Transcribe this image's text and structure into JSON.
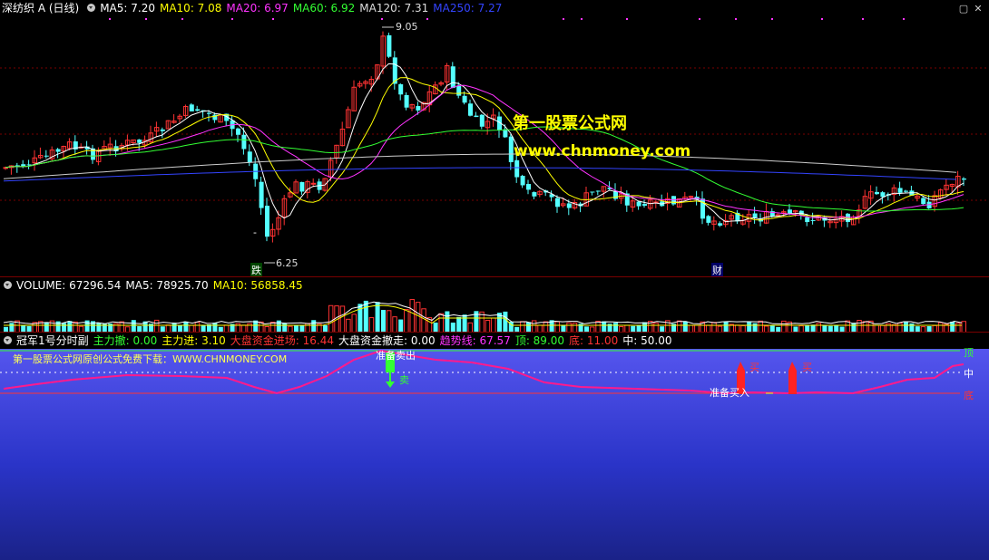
{
  "main": {
    "title": "深纺织 A (日线)",
    "ma_labels": [
      {
        "text": "MA5: 7.20",
        "color": "#ffffff"
      },
      {
        "text": "MA10: 7.08",
        "color": "#ffff00"
      },
      {
        "text": "MA20: 6.97",
        "color": "#ff33ff"
      },
      {
        "text": "MA60: 6.92",
        "color": "#33ff33"
      },
      {
        "text": "MA120: 7.31",
        "color": "#dddddd"
      },
      {
        "text": "MA250: 7.27",
        "color": "#3344ff"
      }
    ],
    "high_label": "9.05",
    "low_label": "6.25",
    "marker_die": "跌",
    "marker_cai": "财",
    "watermark_cn": "第一股票公式网",
    "watermark_url": "www.chnmoney.com",
    "ask_marker": "-"
  },
  "volume": {
    "labels": [
      {
        "text": "VOLUME: 67296.54",
        "color": "#ffffff"
      },
      {
        "text": "MA5: 78925.70",
        "color": "#ffffff"
      },
      {
        "text": "MA10: 56858.45",
        "color": "#ffff00"
      }
    ]
  },
  "indicator": {
    "title": "冠军1号分时副",
    "labels": [
      {
        "text": "主力撤: 0.00",
        "color": "#33ff33"
      },
      {
        "text": "主力进: 3.10",
        "color": "#ffff00"
      },
      {
        "text": "大盘资金进场: 16.44",
        "color": "#ff3333"
      },
      {
        "text": "大盘资金撤走: 0.00",
        "color": "#ffffff"
      },
      {
        "text": "趋势线: 67.57",
        "color": "#ff33ff"
      },
      {
        "text": "顶: 89.00",
        "color": "#33ff33"
      },
      {
        "text": "底: 11.00",
        "color": "#ff3333"
      },
      {
        "text": "中: 50.00",
        "color": "#ffffff"
      }
    ],
    "promo": "第一股票公式网原创公式免费下载：WWW.CHNMONEY.COM",
    "sell_ready": "准备卖出",
    "sell": "卖",
    "buy_ready": "准备买入",
    "buy1": "买",
    "buy2": "买",
    "level_top": "顶",
    "level_mid": "中",
    "level_bottom": "底"
  },
  "colors": {
    "up": "#ff3333",
    "down": "#54ffff",
    "bg": "#000000"
  }
}
